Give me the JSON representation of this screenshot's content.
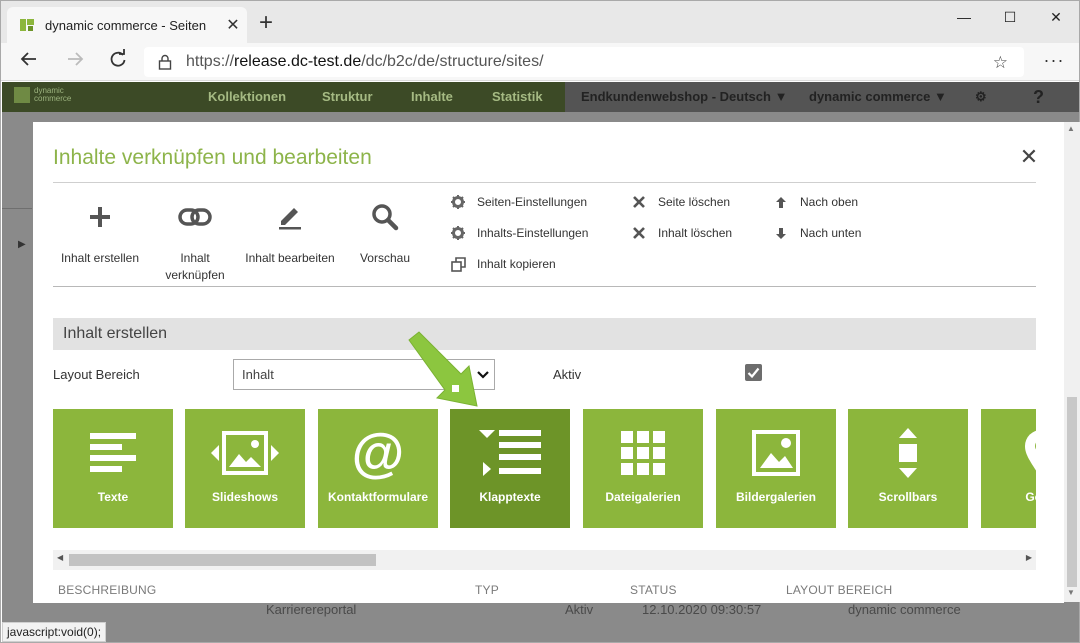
{
  "browser": {
    "tab_title": "dynamic commerce - Seiten",
    "url_prefix": "https://",
    "url_host": "release.dc-test.de",
    "url_path": "/dc/b2c/de/structure/sites/",
    "status_text": "javascript:void(0);"
  },
  "site": {
    "logo_line1": "dynamic",
    "logo_line2": "commerce",
    "nav": [
      "Kollektionen",
      "Struktur",
      "Inhalte",
      "Statistik"
    ],
    "shop_select": "Endkundenwebshop - Deutsch",
    "company_select": "dynamic commerce",
    "help": "?",
    "bg_row": {
      "name": "Karrierereportal",
      "status": "Aktiv",
      "date": "12.10.2020 09:30:57",
      "area": "dynamic commerce"
    }
  },
  "modal": {
    "title": "Inhalte verknüpfen und bearbeiten",
    "big_actions": [
      {
        "label": "Inhalt erstellen",
        "icon": "plus-icon"
      },
      {
        "label": "Inhalt verknüpfen",
        "icon": "link-icon"
      },
      {
        "label": "Inhalt bearbeiten",
        "icon": "pencil-icon"
      },
      {
        "label": "Vorschau",
        "icon": "search-icon"
      }
    ],
    "small_actions": {
      "site_settings": "Seiten-Einstellungen",
      "content_settings": "Inhalts-Einstellungen",
      "copy_content": "Inhalt kopieren",
      "delete_site": "Seite löschen",
      "delete_content": "Inhalt löschen",
      "move_up": "Nach oben",
      "move_down": "Nach unten"
    },
    "section_title": "Inhalt erstellen",
    "layout_label": "Layout Bereich",
    "layout_value": "Inhalt",
    "active_label": "Aktiv",
    "active_checked": true,
    "tiles": [
      {
        "label": "Texte",
        "icon": "text-lines-icon"
      },
      {
        "label": "Slideshows",
        "icon": "slideshow-icon"
      },
      {
        "label": "Kontaktformulare",
        "icon": "at-icon"
      },
      {
        "label": "Klapptexte",
        "icon": "accordion-icon",
        "active": true
      },
      {
        "label": "Dateigalerien",
        "icon": "grid-icon"
      },
      {
        "label": "Bildergalerien",
        "icon": "image-icon"
      },
      {
        "label": "Scrollbars",
        "icon": "scroll-icon"
      },
      {
        "label": "Goog",
        "icon": "map-pin-icon"
      }
    ],
    "columns": [
      "BESCHREIBUNG",
      "TYP",
      "STATUS",
      "LAYOUT BEREICH"
    ],
    "accent_color": "#8cb63c",
    "active_tile_color": "#6d9428",
    "title_color": "#8db44a"
  }
}
